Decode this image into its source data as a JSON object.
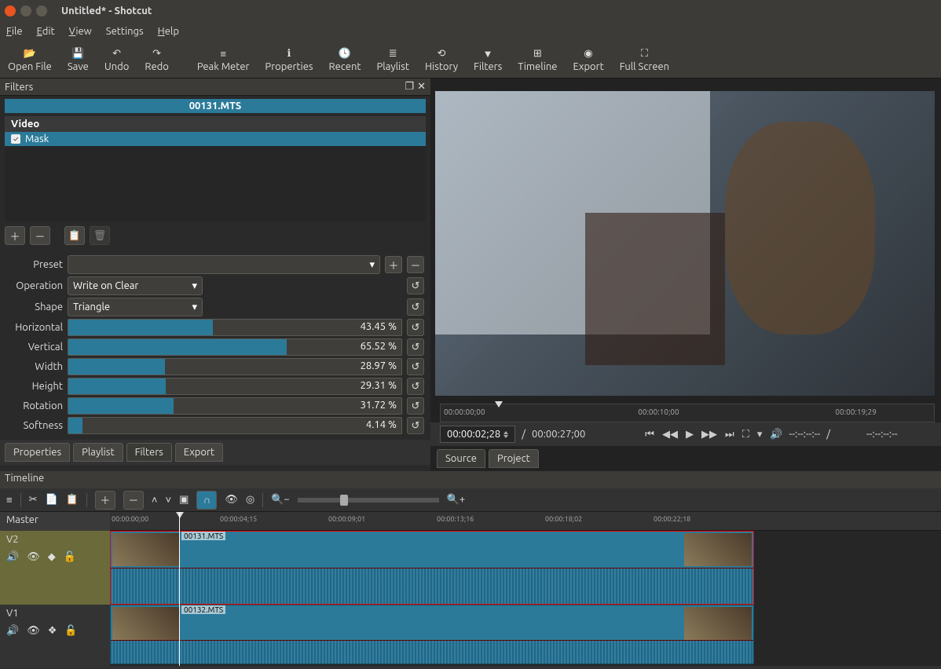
{
  "window": {
    "title": "Untitled* - Shotcut"
  },
  "menubar": [
    "File",
    "Edit",
    "View",
    "Settings",
    "Help"
  ],
  "toolbar": [
    {
      "id": "open-file",
      "label": "Open File"
    },
    {
      "id": "save",
      "label": "Save"
    },
    {
      "id": "undo",
      "label": "Undo"
    },
    {
      "id": "redo",
      "label": "Redo"
    },
    {
      "id": "peak-meter",
      "label": "Peak Meter"
    },
    {
      "id": "properties",
      "label": "Properties"
    },
    {
      "id": "recent",
      "label": "Recent"
    },
    {
      "id": "playlist",
      "label": "Playlist"
    },
    {
      "id": "history",
      "label": "History"
    },
    {
      "id": "filters",
      "label": "Filters"
    },
    {
      "id": "timeline",
      "label": "Timeline"
    },
    {
      "id": "export",
      "label": "Export"
    },
    {
      "id": "full-screen",
      "label": "Full Screen"
    }
  ],
  "filters_panel": {
    "title": "Filters",
    "clip": "00131.MTS",
    "section": "Video",
    "items": [
      {
        "name": "Mask",
        "checked": true
      }
    ],
    "preset_label": "Preset",
    "operation_label": "Operation",
    "operation_value": "Write on Clear",
    "shape_label": "Shape",
    "shape_value": "Triangle",
    "params": [
      {
        "label": "Horizontal",
        "value": "43.45 %",
        "pct": 43.45
      },
      {
        "label": "Vertical",
        "value": "65.52 %",
        "pct": 65.52
      },
      {
        "label": "Width",
        "value": "28.97 %",
        "pct": 28.97
      },
      {
        "label": "Height",
        "value": "29.31 %",
        "pct": 29.31
      },
      {
        "label": "Rotation",
        "value": "31.72 %",
        "pct": 31.72
      },
      {
        "label": "Softness",
        "value": "4.14 %",
        "pct": 4.14
      }
    ]
  },
  "left_tabs": [
    "Properties",
    "Playlist",
    "Filters",
    "Export"
  ],
  "player": {
    "current": "00:00:02;28",
    "total": "00:00:27;00",
    "sep": "/",
    "scrub": [
      "00:00:00;00",
      "00:00:10;00",
      "00:00:19;29"
    ],
    "in_time": "--:--:--:--",
    "out_sep": "/",
    "out_time": "--:--:--:--"
  },
  "source_tabs": [
    "Source",
    "Project"
  ],
  "timeline": {
    "title": "Timeline",
    "master": "Master",
    "ruler": [
      "00:00:00;00",
      "00:00:04;15",
      "00:00:09;01",
      "00:00:13;16",
      "00:00:18;02",
      "00:00:22;18"
    ],
    "tracks": [
      {
        "name": "V2",
        "clip": "00131.MTS"
      },
      {
        "name": "V1",
        "clip": "00132.MTS"
      }
    ]
  }
}
